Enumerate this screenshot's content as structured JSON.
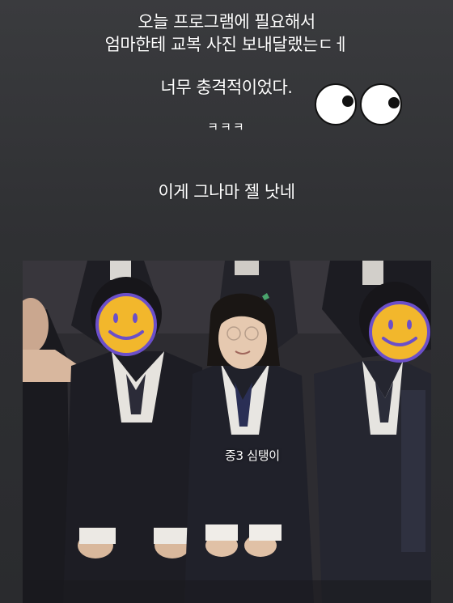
{
  "story": {
    "line1": "오늘 프로그램에 필요해서",
    "line2": "엄마한테 교복 사진 보내달랬는ㄷㅔ",
    "line3": "너무 충격적이었다.",
    "line4": "ㅋㅋㅋ",
    "line5": "이게 그나마 젤 낫네"
  },
  "photo": {
    "caption": "중3 심탱이"
  },
  "colors": {
    "background": "#2f3033",
    "text": "#ffffff",
    "smiley_fill": "#f2b72c",
    "smiley_outline": "#6b4fc9",
    "eye_white": "#ffffff",
    "pupil": "#111111"
  },
  "icons": [
    "googly-eyes-icon",
    "smiley-face-icon"
  ]
}
